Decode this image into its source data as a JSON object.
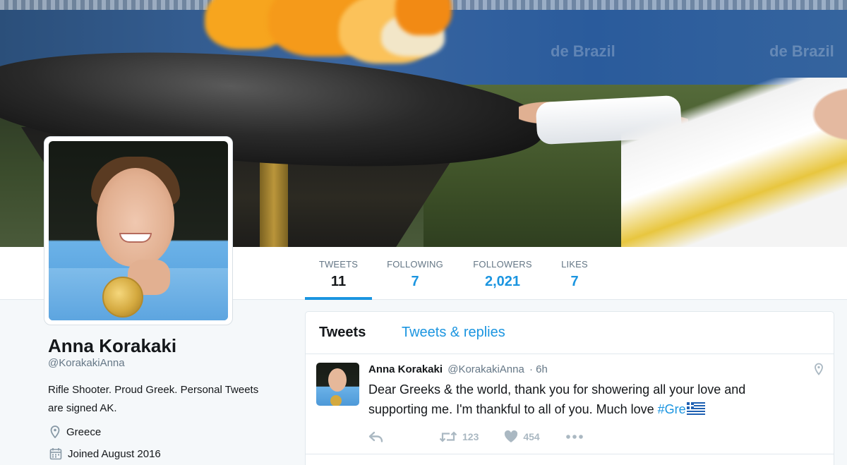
{
  "profile": {
    "name": "Anna Korakaki",
    "handle": "@KorakakiAnna",
    "bio": "Rifle Shooter. Proud Greek. Personal Tweets are signed AK.",
    "location": "Greece",
    "joined": "Joined August 2016"
  },
  "stats": [
    {
      "label": "TWEETS",
      "value": "11"
    },
    {
      "label": "FOLLOWING",
      "value": "7"
    },
    {
      "label": "FOLLOWERS",
      "value": "2,021"
    },
    {
      "label": "LIKES",
      "value": "7"
    }
  ],
  "timeline": {
    "tabs": [
      "Tweets",
      "Tweets & replies"
    ]
  },
  "tweet": {
    "author": "Anna Korakaki",
    "handle": "@KorakakiAnna",
    "time": "· 6h",
    "text": "Dear Greeks & the world, thank you for showering all your love and supporting me. I'm thankful to all of you. Much love ",
    "hashtag": "#Gre",
    "retweets": "123",
    "likes": "454"
  },
  "colors": {
    "accent": "#1b95e0",
    "text": "#14171a",
    "muted": "#657786",
    "background": "#f5f8fa"
  },
  "icons": [
    "location-pin-icon",
    "calendar-icon",
    "reply-icon",
    "retweet-icon",
    "heart-icon",
    "more-icon",
    "greek-flag-icon"
  ]
}
